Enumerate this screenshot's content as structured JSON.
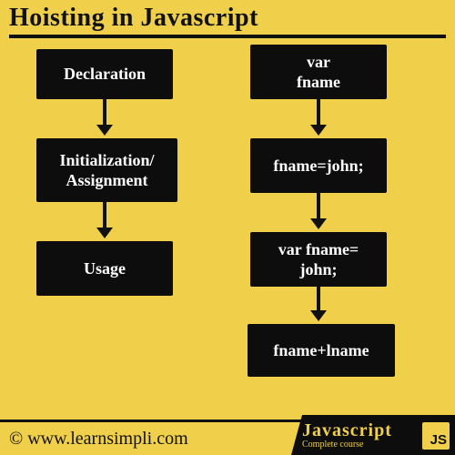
{
  "header": {
    "title": "Hoisting in Javascript"
  },
  "left_column": {
    "box1": "Declaration",
    "box2": "Initialization/\nAssignment",
    "box3": "Usage"
  },
  "right_column": {
    "box1": "var\nfname",
    "box2": "fname=john;",
    "box3": "var fname=\njohn;",
    "box4": "fname+lname"
  },
  "footer": {
    "url": "© www.learnsimpli.com",
    "badge_title": "Javascript",
    "badge_sub": "Complete course",
    "js_label": "JS"
  }
}
